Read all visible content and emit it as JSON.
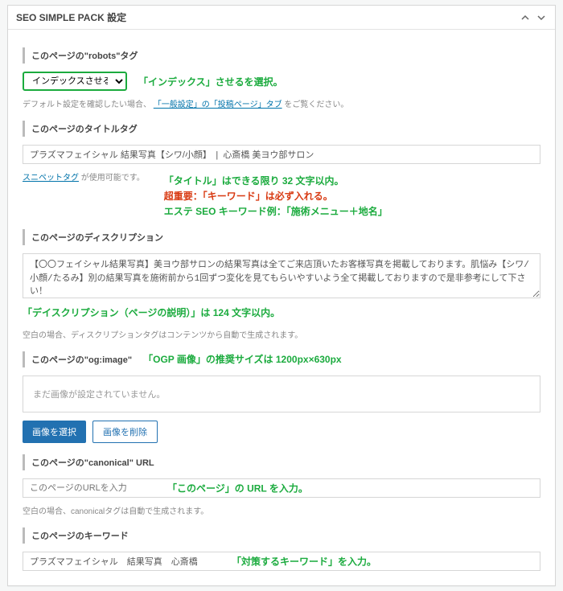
{
  "panel": {
    "title": "SEO SIMPLE PACK 設定"
  },
  "robots": {
    "heading": "このページの\"robots\"タグ",
    "select_value": "インデックスさせる",
    "annotation": "「インデックス」させるを選択。",
    "help_pre": "デフォルト設定を確認したい場合、",
    "help_link": "「一般設定」の「投稿ページ」タブ",
    "help_post": " をご覧ください。"
  },
  "title": {
    "heading": "このページのタイトルタグ",
    "value": "プラズマフェイシャル 結果写真【シワ/小顔】　|  心斎橋 美ヨウ部サロン",
    "snippet_link": "スニペットタグ",
    "snippet_after": " が使用可能です。",
    "annot1": "「タイトル」はできる限り 32 文字以内。",
    "annot2": "超重要：「キーワード」は必ず入れる。",
    "annot3": "エステ SEO キーワード例：「施術メニュー＋地名」"
  },
  "description": {
    "heading": "このページのディスクリプション",
    "value": "【〇〇フェイシャル結果写真】美ヨウ部サロンの結果写真は全てご来店頂いたお客様写真を掲載しております。肌悩み【シワ/小顔/たるみ】別の結果写真を施術前から1回ずつ変化を見てもらいやすいよう全て掲載しておりますので是非参考にして下さい！",
    "annot": "「デイスクリプション（ページの説明）」は 124 文字以内。",
    "note": "空白の場合、ディスクリプションタグはコンテンツから自動で生成されます。"
  },
  "ogp": {
    "heading": "このページの\"og:image\"",
    "annotation": "「OGP 画像」の推奨サイズは 1200px×630px",
    "placeholder_text": "まだ画像が設定されていません。",
    "btn_select": "画像を選択",
    "btn_delete": "画像を削除"
  },
  "canonical": {
    "heading": "このページの\"canonical\" URL",
    "placeholder": "このページのURLを入力",
    "annotation": "「このページ」の URL を入力。",
    "note": "空白の場合、canonicalタグは自動で生成されます。"
  },
  "keywords": {
    "heading": "このページのキーワード",
    "value": "プラズマフェイシャル　結果写真　心斎橋",
    "annotation": "「対策するキーワード」を入力。"
  }
}
